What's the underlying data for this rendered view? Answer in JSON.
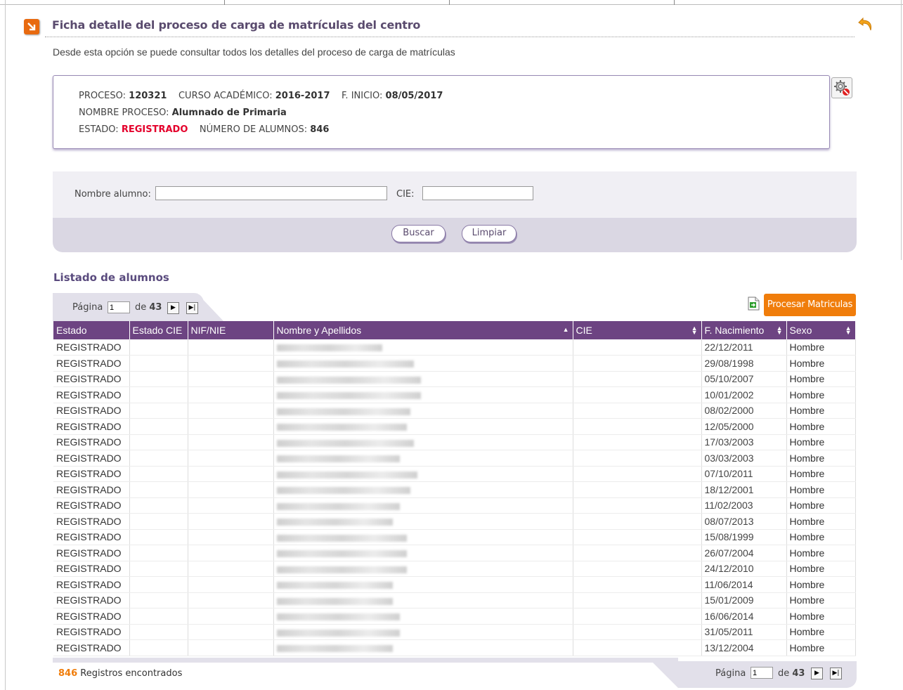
{
  "header": {
    "title": "Ficha detalle del proceso de carga de matrículas del centro",
    "subtitle": "Desde esta opción se puede consultar todos los detalles del proceso de carga de matrículas"
  },
  "process": {
    "proceso_label": "PROCESO:",
    "proceso_value": "120321",
    "curso_label": "CURSO ACADÉMICO:",
    "curso_value": "2016-2017",
    "inicio_label": "F. INICIO:",
    "inicio_value": "08/05/2017",
    "nombre_label": "NOMBRE PROCESO:",
    "nombre_value": "Alumnado de Primaria",
    "estado_label": "ESTADO:",
    "estado_value": "REGISTRADO",
    "num_label": "NÚMERO DE ALUMNOS:",
    "num_value": "846",
    "status_color": "#e4002b"
  },
  "filters": {
    "nombre_label": "Nombre alumno:",
    "nombre_value": "",
    "cie_label": "CIE:",
    "cie_value": "",
    "buscar": "Buscar",
    "limpiar": "Limpiar"
  },
  "list": {
    "title": "Listado de alumnos",
    "pagina_label": "Página",
    "page": "1",
    "de_label": "de",
    "total_pages": "43",
    "procesar": "Procesar Matriculas",
    "columns": [
      "Estado",
      "Estado CIE",
      "NIF/NIE",
      "Nombre y Apellidos",
      "CIE",
      "F. Nacimiento",
      "Sexo"
    ],
    "rows": [
      {
        "estado": "REGISTRADO",
        "fecha": "22/12/2011",
        "sexo": "Hombre"
      },
      {
        "estado": "REGISTRADO",
        "fecha": "29/08/1998",
        "sexo": "Hombre"
      },
      {
        "estado": "REGISTRADO",
        "fecha": "05/10/2007",
        "sexo": "Hombre"
      },
      {
        "estado": "REGISTRADO",
        "fecha": "10/01/2002",
        "sexo": "Hombre"
      },
      {
        "estado": "REGISTRADO",
        "fecha": "08/02/2000",
        "sexo": "Hombre"
      },
      {
        "estado": "REGISTRADO",
        "fecha": "12/05/2000",
        "sexo": "Hombre"
      },
      {
        "estado": "REGISTRADO",
        "fecha": "17/03/2003",
        "sexo": "Hombre"
      },
      {
        "estado": "REGISTRADO",
        "fecha": "03/03/2003",
        "sexo": "Hombre"
      },
      {
        "estado": "REGISTRADO",
        "fecha": "07/10/2011",
        "sexo": "Hombre"
      },
      {
        "estado": "REGISTRADO",
        "fecha": "18/12/2001",
        "sexo": "Hombre"
      },
      {
        "estado": "REGISTRADO",
        "fecha": "11/02/2003",
        "sexo": "Hombre"
      },
      {
        "estado": "REGISTRADO",
        "fecha": "08/07/2013",
        "sexo": "Hombre"
      },
      {
        "estado": "REGISTRADO",
        "fecha": "15/08/1999",
        "sexo": "Hombre"
      },
      {
        "estado": "REGISTRADO",
        "fecha": "26/07/2004",
        "sexo": "Hombre"
      },
      {
        "estado": "REGISTRADO",
        "fecha": "24/12/2010",
        "sexo": "Hombre"
      },
      {
        "estado": "REGISTRADO",
        "fecha": "11/06/2014",
        "sexo": "Hombre"
      },
      {
        "estado": "REGISTRADO",
        "fecha": "15/01/2009",
        "sexo": "Hombre"
      },
      {
        "estado": "REGISTRADO",
        "fecha": "16/06/2014",
        "sexo": "Hombre"
      },
      {
        "estado": "REGISTRADO",
        "fecha": "31/05/2011",
        "sexo": "Hombre"
      },
      {
        "estado": "REGISTRADO",
        "fecha": "13/12/2004",
        "sexo": "Hombre"
      }
    ]
  },
  "footer": {
    "count": "846",
    "count_label": "Registros encontrados",
    "pagina_label": "Página",
    "page": "1",
    "de_label": "de",
    "total_pages": "43"
  },
  "colors": {
    "accent": "#f07d0b",
    "header_purple": "#6d4482",
    "title_purple": "#5a4b6e"
  },
  "icons": [
    "arrow-down-right-icon",
    "back-arrow-icon",
    "gear-cancel-icon",
    "export-icon",
    "next-page-icon",
    "last-page-icon",
    "sort-icon"
  ]
}
